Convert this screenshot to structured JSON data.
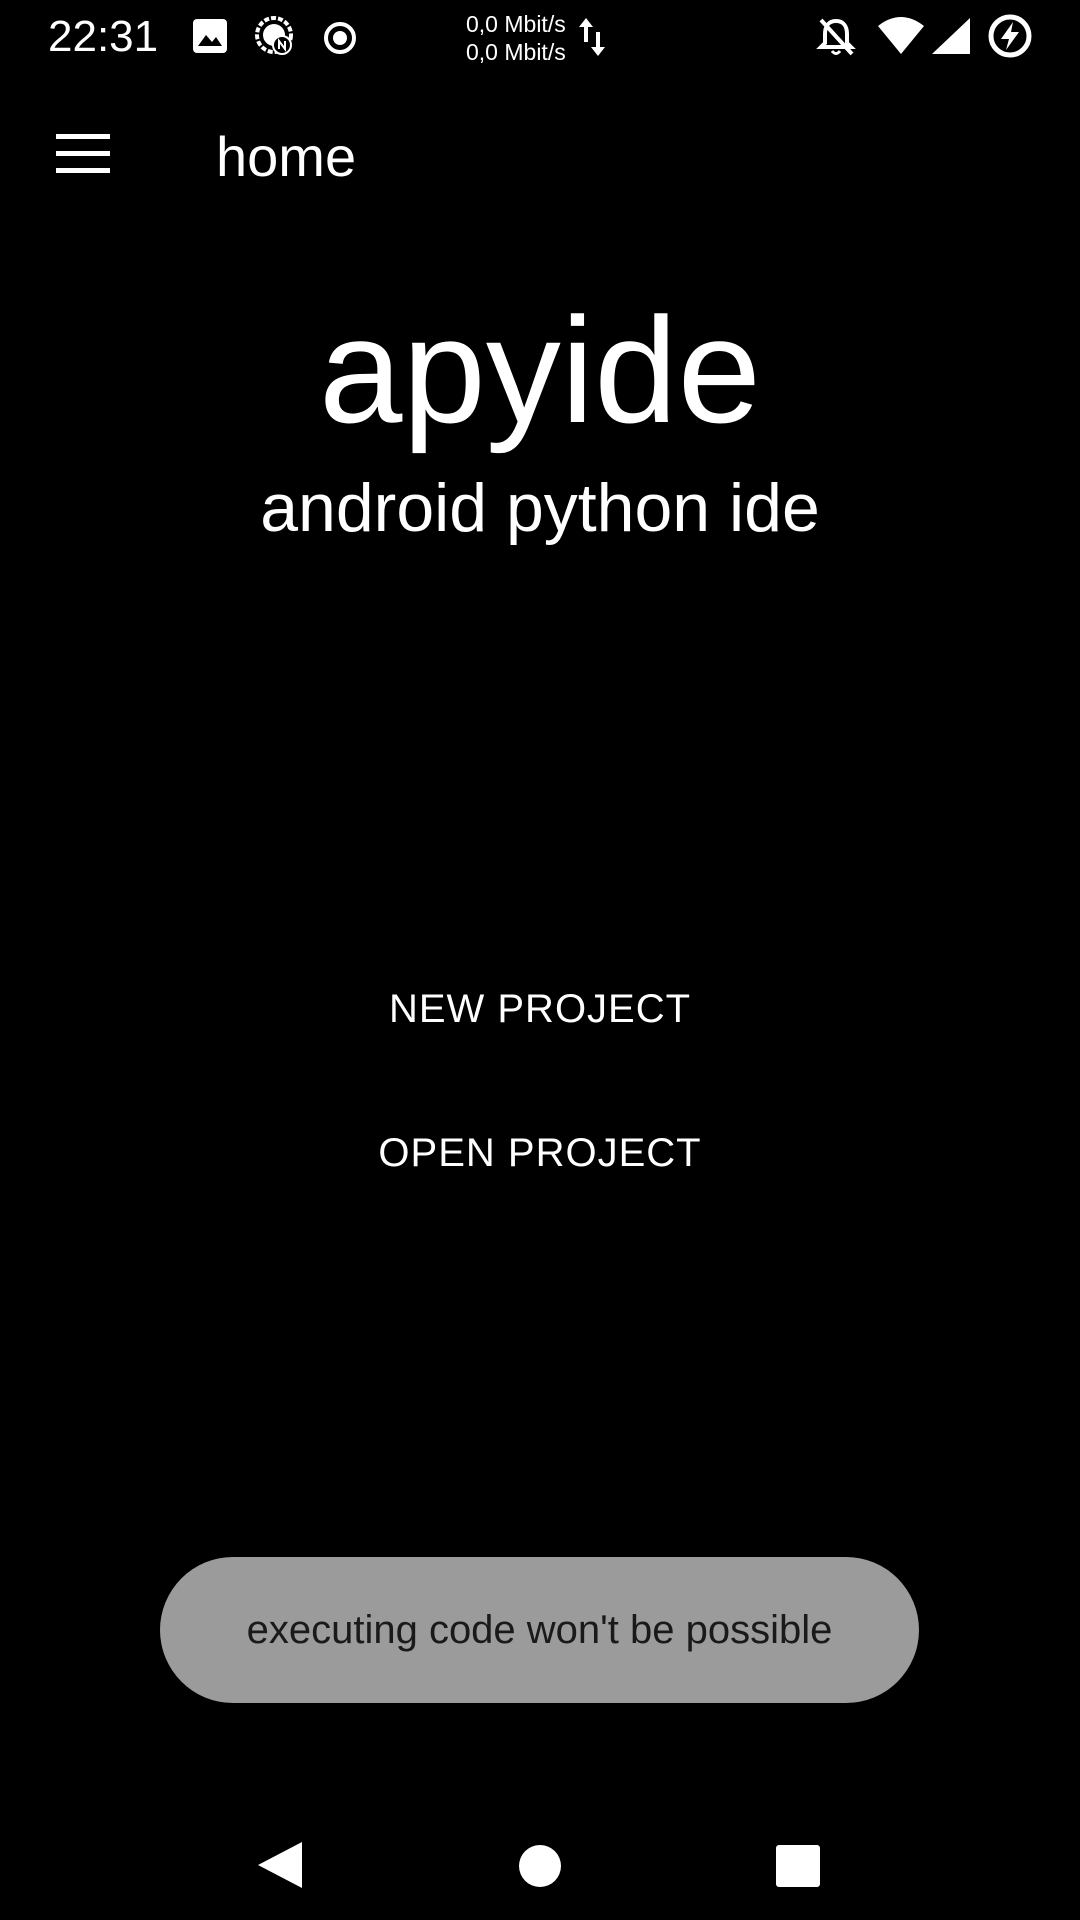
{
  "status_bar": {
    "time": "22:31",
    "net_up": "0,0 Mbit/s",
    "net_down": "0,0 Mbit/s",
    "icons": [
      "gallery-icon",
      "chat-bubble-icon",
      "record-icon",
      "data-arrows-icon",
      "bell-off-icon",
      "wifi-icon",
      "signal-icon",
      "battery-charging-icon"
    ]
  },
  "app_bar": {
    "title": "home"
  },
  "hero": {
    "title": "apyide",
    "subtitle": "android python ide"
  },
  "buttons": {
    "new_project": "NEW PROJECT",
    "open_project": "OPEN PROJECT"
  },
  "toast": {
    "message": "executing code won't be possible"
  },
  "colors": {
    "background": "#000000",
    "text": "#ffffff",
    "toast_bg": "#9b9b9b",
    "toast_text": "#1a1a1a"
  }
}
